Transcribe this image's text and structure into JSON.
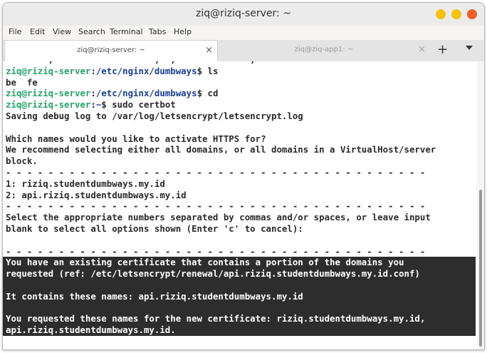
{
  "window": {
    "title": "ziq@riziq-server: ~"
  },
  "menu": [
    "File",
    "Edit",
    "View",
    "Search",
    "Terminal",
    "Tabs",
    "Help"
  ],
  "tabs": [
    {
      "label": "ziq@riziq-server: ~",
      "close": "×"
    },
    {
      "label": "ziq@ziq-app1: ~",
      "close": "×"
    }
  ],
  "new_tab_label": "+",
  "prompt": {
    "user": "ziq@riziq-server",
    "colon": ":",
    "dir_dumbways": "/etc/nginx/dumbways",
    "dir_home": "~",
    "suffix_cmd_ls": "$ ls",
    "suffix_cmd_cd": "$ cd",
    "suffix_cmd_certbot": "$ sudo certbot"
  },
  "output": {
    "partial_top": "        ,                   ,  ,              ,",
    "ls_result": "be  fe",
    "debug_log": "Saving debug log to /var/log/letsencrypt/letsencrypt.log",
    "blank": "",
    "question": "Which names would you like to activate HTTPS for?",
    "recommend1": "We recommend selecting either all domains, or all domains in a VirtualHost/server",
    "recommend2": "block.",
    "dashes": "- - - - - - - - - - - - - - - - - - - - - - - - - - - - - - - - - - - - - - - -",
    "option1": "1: riziq.studentdumbways.my.id",
    "option2": "2: api.riziq.studentdumbways.my.id",
    "select1": "Select the appropriate numbers separated by commas and/or spaces, or leave input",
    "select2": "blank to select all options shown (Enter 'c' to cancel):",
    "existing1": "You have an existing certificate that contains a portion of the domains you",
    "existing2": "requested (ref: /etc/letsencrypt/renewal/api.riziq.studentdumbways.my.id.conf)",
    "contains": "It contains these names: api.riziq.studentdumbways.my.id",
    "requested1": "You requested these names for the new certificate: riziq.studentdumbways.my.id,",
    "requested2": "api.riziq.studentdumbways.my.id."
  }
}
